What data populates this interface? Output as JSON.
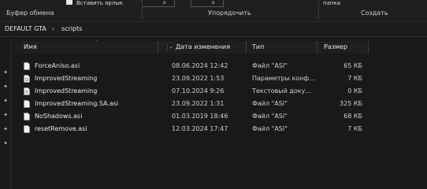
{
  "ribbon": {
    "paste_shortcut_label": "Вставить ярлык",
    "clipboard_group": "Буфер обмена",
    "organize_group": "Упорядочить",
    "create_group": "Создать",
    "folder_button": "папка",
    "combo_a": "в",
    "combo_b": "в"
  },
  "breadcrumb": {
    "root": "DEFAULT GTA",
    "current": "scripts",
    "separator": "›"
  },
  "columns": {
    "name": "Имя",
    "date": "Дата изменения",
    "type": "Тип",
    "size": "Размер"
  },
  "files": [
    {
      "name": "ForceAniso.asi",
      "date": "08.06.2024 12:42",
      "type": "Файл \"ASI\"",
      "size": "65 КБ",
      "icon": "file-icon"
    },
    {
      "name": "ImprovedStreaming",
      "date": "23.09.2022 1:53",
      "type": "Параметры конф...",
      "size": "7 КБ",
      "icon": "config-file-icon"
    },
    {
      "name": "ImprovedStreaming",
      "date": "07.10.2024 9:26",
      "type": "Текстовый доку...",
      "size": "0 КБ",
      "icon": "text-file-icon"
    },
    {
      "name": "ImprovedStreaming.SA.asi",
      "date": "23.09.2022 1:31",
      "type": "Файл \"ASI\"",
      "size": "325 КБ",
      "icon": "file-icon"
    },
    {
      "name": "NoShadows.asi",
      "date": "01.03.2019 18:46",
      "type": "Файл \"ASI\"",
      "size": "68 КБ",
      "icon": "file-icon"
    },
    {
      "name": "resetRemove.asi",
      "date": "12.03.2024 17:47",
      "type": "Файл \"ASI\"",
      "size": "7 КБ",
      "icon": "file-icon"
    }
  ],
  "quick_access_pins": [
    "pin-icon",
    "pin-icon",
    "pin-icon",
    "pin-icon",
    "pin-icon",
    "pin-icon"
  ]
}
